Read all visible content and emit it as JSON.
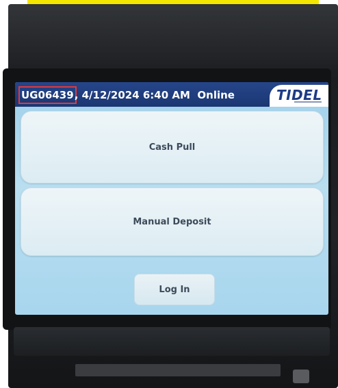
{
  "status_bar": {
    "unit_id": "UG06439",
    "separator": ",",
    "datetime": "4/12/2024 6:40 AM",
    "connection": "Online",
    "brand": "TIDEL"
  },
  "menu": {
    "cash_pull_label": "Cash Pull",
    "manual_deposit_label": "Manual Deposit",
    "login_label": "Log In"
  },
  "colors": {
    "status_bar": "#1b3672",
    "screen": "#a8d6ee",
    "highlight": "#e0393e",
    "banner": "#f5e600"
  }
}
